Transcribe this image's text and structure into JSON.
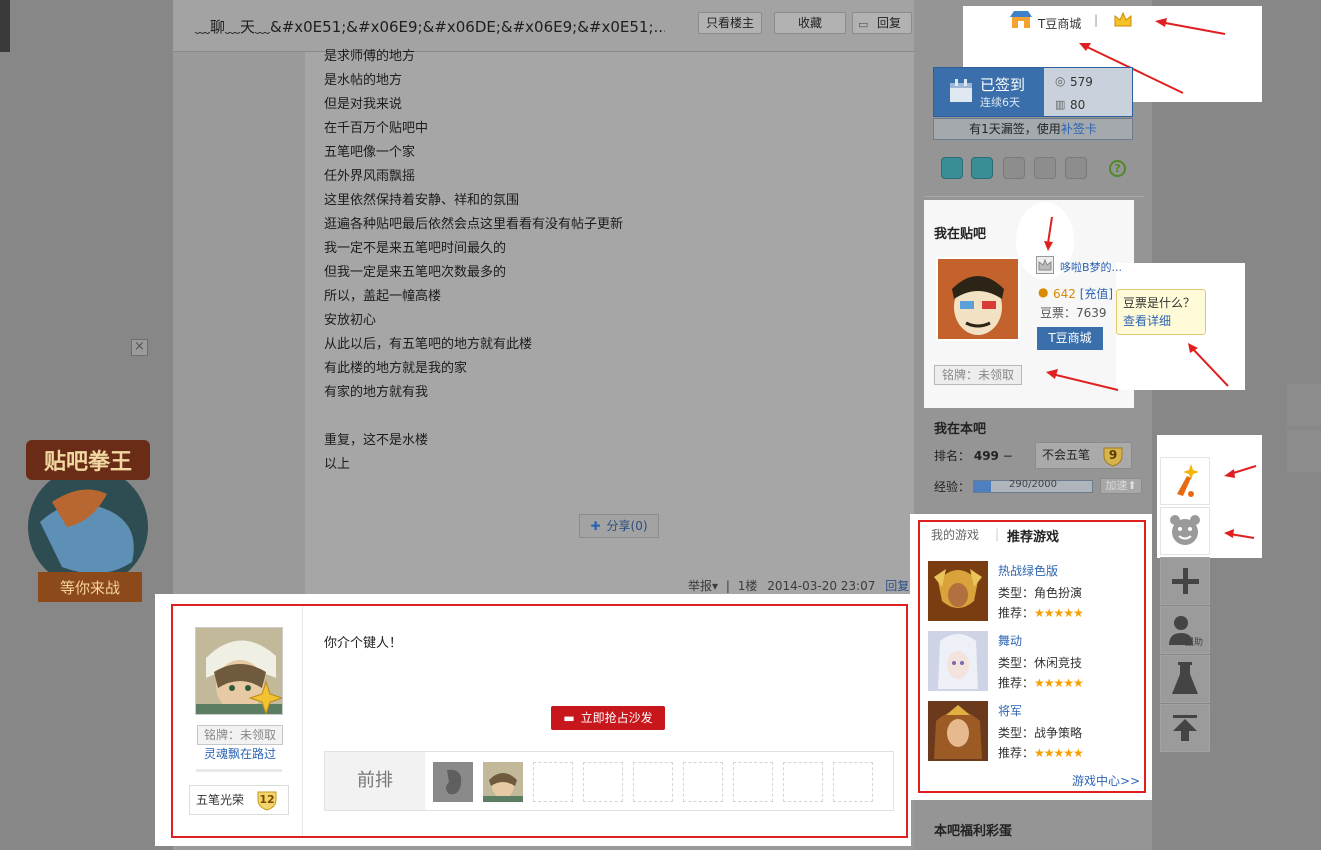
{
  "header": {
    "thread_title": "﹏聊﹏天﹏&#x0E51;&#x06E9;&#x06DE;&#x06E9;&#x0E51;...",
    "only_op_label": "只看楼主",
    "favorite_label": "收藏",
    "reply_label": "回复"
  },
  "post": {
    "lines": [
      "是求师傅的地方",
      "是水帖的地方",
      "但是对我来说",
      "在千百万个贴吧中",
      "五笔吧像一个家",
      "任外界风雨飘摇",
      "这里依然保持着安静、祥和的氛围",
      "逛遍各种贴吧最后依然会点这里看看有没有帖子更新",
      "我一定不是来五笔吧时间最久的",
      "但我一定是来五笔吧次数最多的",
      "所以，盖起一幢高楼",
      "安放初心",
      "从此以后，有五笔吧的地方就有此楼",
      "有此楼的地方就是我的家",
      "有家的地方就有我",
      "",
      "重复，这不是水楼",
      "以上"
    ],
    "share_label": "分享(0)",
    "meta": {
      "report": "举报",
      "floor": "1楼",
      "time": "2014-03-20 23:07",
      "reply": "回复"
    }
  },
  "ad": {
    "close": "×",
    "title": "贴吧拳王",
    "cta": "等你来战"
  },
  "reply": {
    "badge": "铭牌：未领取",
    "username": "灵魂飘在路过",
    "honor_label": "五笔光荣",
    "honor_level": "12",
    "text": "你介个键人！",
    "sofa_label": "立即抢占沙发",
    "front_row_label": "前排"
  },
  "sidebar": {
    "tdou_mall_link": "T豆商城",
    "separator": "|",
    "signin": {
      "label": "已签到",
      "sub": "连续6天",
      "count": "579",
      "rank": "80",
      "makeup_text": "有1天漏签，使用",
      "makeup_link": "补签卡"
    },
    "help": "?",
    "my_tieba": {
      "heading": "我在贴吧",
      "username": "哆啦B梦的...",
      "coins": "642",
      "recharge": "[充值]",
      "beans": "豆票：7639",
      "tdou_button": "T豆商城",
      "badge": "铭牌：未领取",
      "tip_title": "豆票是什么？",
      "tip_link": "查看详细"
    },
    "this_bar": {
      "heading": "我在本吧",
      "rank_label": "排名：",
      "rank_value": "499",
      "rank_trend": "−",
      "level_name": "不会五笔",
      "level_num": "9",
      "exp_label": "经验：",
      "exp_text": "290/2000",
      "exp_fraction": 0.145,
      "add_exp": "加速"
    },
    "games": {
      "tab_mine": "我的游戏",
      "tab_sep": "|",
      "tab_recommended": "推荐游戏",
      "items": [
        {
          "name": "热战绿色版",
          "type": "类型：角色扮演",
          "rec": "推荐：",
          "stars": "★★★★★"
        },
        {
          "name": "舞动",
          "type": "类型：休闲竞技",
          "rec": "推荐：",
          "stars": "★★★★★"
        },
        {
          "name": "将军",
          "type": "类型：战争策略",
          "rec": "推荐：",
          "stars": "★★★★★"
        }
      ],
      "center_link": "游戏中心>>"
    },
    "welfare_heading": "本吧福利彩蛋"
  },
  "right_toolbar": {
    "help_label": "援助"
  },
  "colors": {
    "highlight_red": "#e02020",
    "link_blue": "#2d64b3",
    "sofa_red": "#c8161d",
    "star_orange": "#f5a000"
  }
}
